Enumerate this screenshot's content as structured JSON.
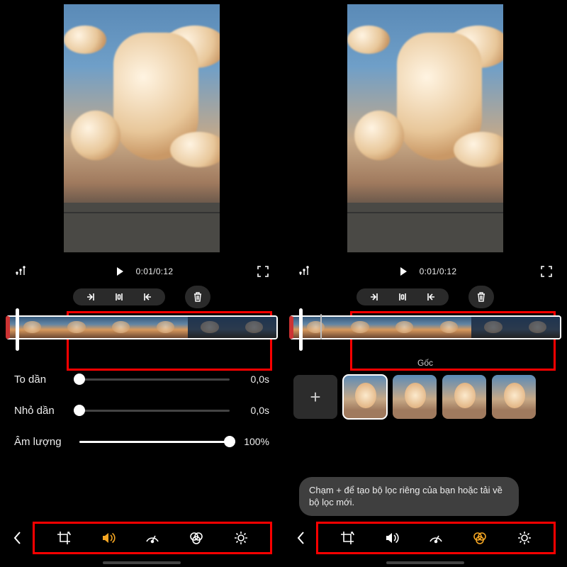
{
  "left": {
    "time": "0:01/0:12",
    "sliders": {
      "fade_in": {
        "label": "To dần",
        "value_text": "0,0s",
        "percent": 0
      },
      "fade_out": {
        "label": "Nhỏ dần",
        "value_text": "0,0s",
        "percent": 0
      },
      "volume": {
        "label": "Âm lượng",
        "value_text": "100%",
        "percent": 100
      }
    },
    "active_tool": "sound"
  },
  "right": {
    "time": "0:01/0:12",
    "filters": {
      "original_label": "Gốc",
      "add_label": "+",
      "tooltip": "Chạm + để tạo bộ lọc riêng của bạn hoặc tải về bộ lọc mới."
    },
    "active_tool": "filter"
  },
  "tools": {
    "crop": "crop-rotate",
    "sound": "sound",
    "speed": "speed",
    "filter": "filter",
    "adjust": "adjust"
  }
}
